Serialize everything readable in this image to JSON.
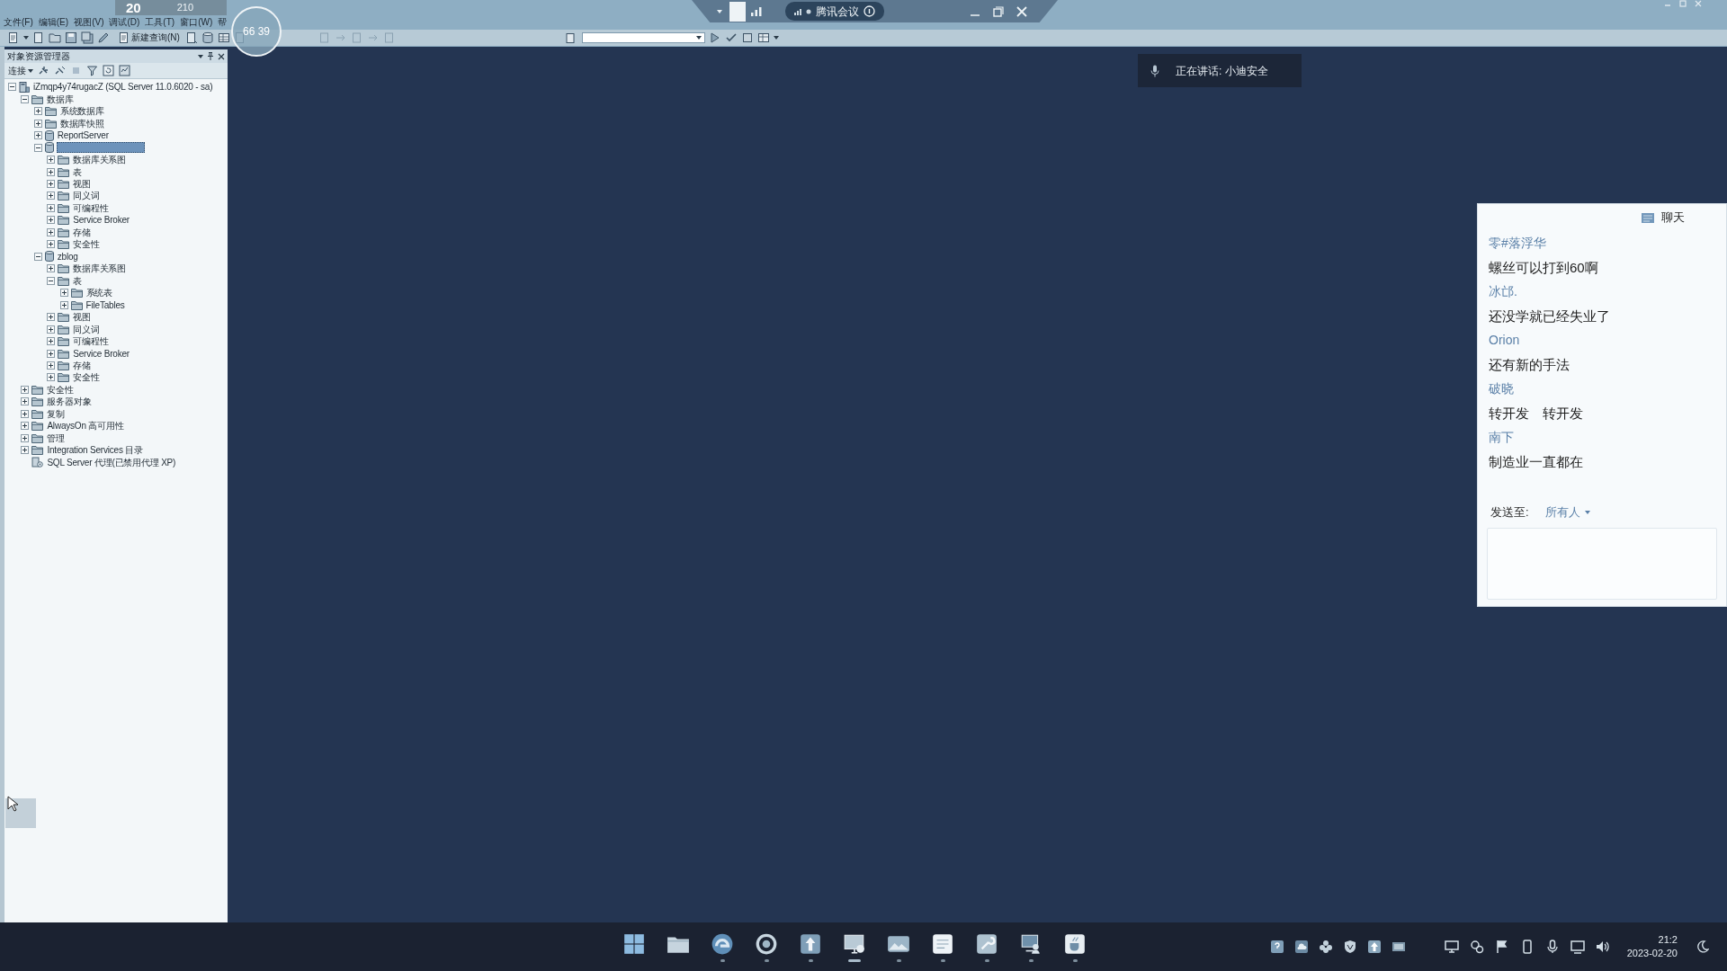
{
  "overlay_stats": [
    "20",
    "210"
  ],
  "floating_ball": {
    "text": "66 39"
  },
  "meeting_bar": {
    "title": "腾讯会议"
  },
  "menu": [
    "文件(F)",
    "编辑(E)",
    "视图(V)",
    "调试(D)",
    "工具(T)",
    "窗口(W)",
    "帮"
  ],
  "toolbar": {
    "new_query_label": "新建查询(N)"
  },
  "object_explorer": {
    "title": "对象资源管理器",
    "connect_label": "连接",
    "tree": [
      {
        "kind": "server",
        "label": "iZmqp4y74rugacZ (SQL Server 11.0.6020 - sa)",
        "expanded": true,
        "selected": false,
        "children": [
          {
            "kind": "folder",
            "label": "数据库",
            "expanded": true,
            "selected": false,
            "children": [
              {
                "kind": "folder",
                "label": "系统数据库",
                "expanded": false,
                "selected": false
              },
              {
                "kind": "folder",
                "label": "数据库快照",
                "expanded": false,
                "selected": false
              },
              {
                "kind": "database",
                "label": "ReportServer",
                "expanded": false,
                "selected": false
              },
              {
                "kind": "database",
                "expanded": true,
                "selected": true,
                "children": [
                  {
                    "kind": "folder",
                    "label": "数据库关系图",
                    "expanded": false,
                    "selected": false
                  },
                  {
                    "kind": "folder",
                    "label": "表",
                    "expanded": false,
                    "selected": false
                  },
                  {
                    "kind": "folder",
                    "label": "视图",
                    "expanded": false,
                    "selected": false
                  },
                  {
                    "kind": "folder",
                    "label": "同义词",
                    "expanded": false,
                    "selected": false
                  },
                  {
                    "kind": "folder",
                    "label": "可编程性",
                    "expanded": false,
                    "selected": false
                  },
                  {
                    "kind": "folder",
                    "label": "Service Broker",
                    "expanded": false,
                    "selected": false
                  },
                  {
                    "kind": "folder",
                    "label": "存储",
                    "expanded": false,
                    "selected": false
                  },
                  {
                    "kind": "folder",
                    "label": "安全性",
                    "expanded": false,
                    "selected": false
                  }
                ]
              },
              {
                "kind": "database",
                "label": "zblog",
                "expanded": true,
                "selected": false,
                "children": [
                  {
                    "kind": "folder",
                    "label": "数据库关系图",
                    "expanded": false,
                    "selected": false
                  },
                  {
                    "kind": "folder",
                    "label": "表",
                    "expanded": true,
                    "selected": false,
                    "children": [
                      {
                        "kind": "folder",
                        "label": "系统表",
                        "expanded": false,
                        "selected": false
                      },
                      {
                        "kind": "folder",
                        "label": "FileTables",
                        "expanded": false,
                        "selected": false
                      }
                    ]
                  },
                  {
                    "kind": "folder",
                    "label": "视图",
                    "expanded": false,
                    "selected": false
                  },
                  {
                    "kind": "folder",
                    "label": "同义词",
                    "expanded": false,
                    "selected": false
                  },
                  {
                    "kind": "folder",
                    "label": "可编程性",
                    "expanded": false,
                    "selected": false
                  },
                  {
                    "kind": "folder",
                    "label": "Service Broker",
                    "expanded": false,
                    "selected": false
                  },
                  {
                    "kind": "folder",
                    "label": "存储",
                    "expanded": false,
                    "selected": false
                  },
                  {
                    "kind": "folder",
                    "label": "安全性",
                    "expanded": false,
                    "selected": false
                  }
                ]
              }
            ]
          },
          {
            "kind": "folder",
            "label": "安全性",
            "expanded": false,
            "selected": false
          },
          {
            "kind": "folder",
            "label": "服务器对象",
            "expanded": false,
            "selected": false
          },
          {
            "kind": "folder",
            "label": "复制",
            "expanded": false,
            "selected": false
          },
          {
            "kind": "folder",
            "label": "AlwaysOn 高可用性",
            "expanded": false,
            "selected": false
          },
          {
            "kind": "folder",
            "label": "管理",
            "expanded": false,
            "selected": false
          },
          {
            "kind": "folder",
            "label": "Integration Services 目录",
            "expanded": false,
            "selected": false
          },
          {
            "kind": "agent",
            "label": "SQL Server 代理(已禁用代理 XP)",
            "selected": false
          }
        ]
      }
    ]
  },
  "speaker_banner": {
    "text": "正在讲话: 小迪安全"
  },
  "chat": {
    "title": "聊天",
    "messages": [
      {
        "sender": "零#落浮华",
        "text": "螺丝可以打到60啊"
      },
      {
        "sender": "冰邙.",
        "text": "还没学就已经失业了"
      },
      {
        "sender": "Orion",
        "text": "还有新的手法"
      },
      {
        "sender": "破晓",
        "text": "转开发　转开发"
      },
      {
        "sender": "南下",
        "text": "制造业一直都在"
      }
    ],
    "send_to_label": "发送至:",
    "recipient": "所有人"
  },
  "taskbar": {
    "apps": [
      {
        "kind": "start",
        "running": false,
        "focused": false
      },
      {
        "kind": "folder",
        "running": false,
        "focused": false
      },
      {
        "kind": "swirl",
        "running": true,
        "focused": false
      },
      {
        "kind": "ring",
        "running": true,
        "focused": false
      },
      {
        "kind": "upload",
        "running": true,
        "focused": false
      },
      {
        "kind": "monitor",
        "running": true,
        "focused": true
      },
      {
        "kind": "landscape",
        "running": true,
        "focused": false
      },
      {
        "kind": "note",
        "running": true,
        "focused": false
      },
      {
        "kind": "wrench",
        "running": true,
        "focused": false
      },
      {
        "kind": "computer",
        "running": true,
        "focused": false
      },
      {
        "kind": "cup",
        "running": true,
        "focused": false
      }
    ],
    "time": "21:2",
    "date": "2023-02-20"
  }
}
